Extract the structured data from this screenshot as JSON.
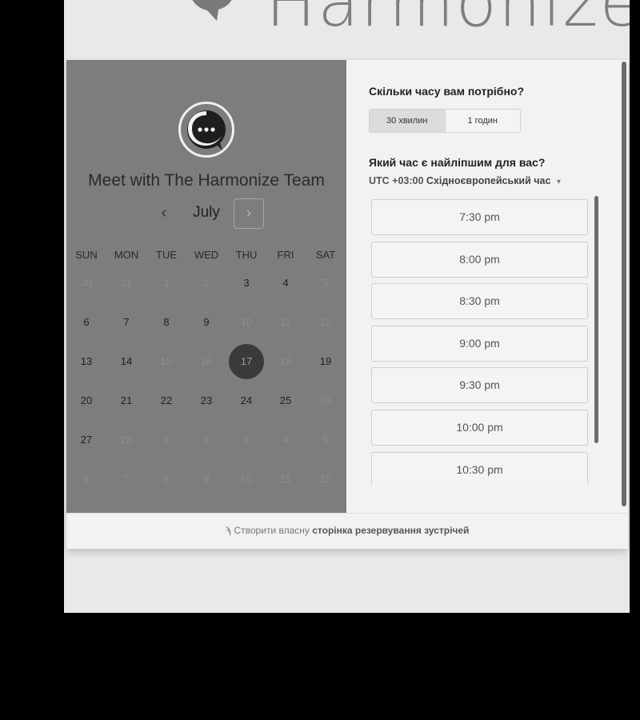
{
  "header": {
    "logo_text": "Harmonize"
  },
  "left_panel": {
    "title": "Meet with The Harmonize Team",
    "month": "July",
    "prev_icon": "‹",
    "next_icon": "›",
    "days_of_week": [
      "SUN",
      "MON",
      "TUE",
      "WED",
      "THU",
      "FRI",
      "SAT"
    ],
    "weeks": [
      [
        {
          "d": "30",
          "s": "past"
        },
        {
          "d": "31",
          "s": "past"
        },
        {
          "d": "1",
          "s": "past"
        },
        {
          "d": "2",
          "s": "past"
        },
        {
          "d": "3",
          "s": "avail"
        },
        {
          "d": "4",
          "s": "avail"
        },
        {
          "d": "5",
          "s": "past"
        }
      ],
      [
        {
          "d": "6",
          "s": "avail"
        },
        {
          "d": "7",
          "s": "avail"
        },
        {
          "d": "8",
          "s": "avail"
        },
        {
          "d": "9",
          "s": "avail"
        },
        {
          "d": "10",
          "s": "past"
        },
        {
          "d": "11",
          "s": "past"
        },
        {
          "d": "12",
          "s": "past"
        }
      ],
      [
        {
          "d": "13",
          "s": "avail"
        },
        {
          "d": "14",
          "s": "avail"
        },
        {
          "d": "15",
          "s": "past"
        },
        {
          "d": "16",
          "s": "past"
        },
        {
          "d": "17",
          "s": "selected"
        },
        {
          "d": "18",
          "s": "past"
        },
        {
          "d": "19",
          "s": "avail"
        }
      ],
      [
        {
          "d": "20",
          "s": "avail"
        },
        {
          "d": "21",
          "s": "avail"
        },
        {
          "d": "22",
          "s": "avail"
        },
        {
          "d": "23",
          "s": "avail"
        },
        {
          "d": "24",
          "s": "avail"
        },
        {
          "d": "25",
          "s": "avail"
        },
        {
          "d": "26",
          "s": "past"
        }
      ],
      [
        {
          "d": "27",
          "s": "avail"
        },
        {
          "d": "28",
          "s": "past"
        },
        {
          "d": "1",
          "s": "past"
        },
        {
          "d": "2",
          "s": "past"
        },
        {
          "d": "3",
          "s": "past"
        },
        {
          "d": "4",
          "s": "past"
        },
        {
          "d": "5",
          "s": "past"
        }
      ],
      [
        {
          "d": "6",
          "s": "past"
        },
        {
          "d": "7",
          "s": "past"
        },
        {
          "d": "8",
          "s": "past"
        },
        {
          "d": "9",
          "s": "past"
        },
        {
          "d": "10",
          "s": "past"
        },
        {
          "d": "11",
          "s": "past"
        },
        {
          "d": "12",
          "s": "past"
        }
      ]
    ]
  },
  "right_panel": {
    "duration_question": "Скільки часу вам потрібно?",
    "durations": [
      "30 хвилин",
      "1 годин"
    ],
    "selected_duration": "30 хвилин",
    "time_question": "Який час є найліпшим для вас?",
    "timezone_offset": "UTC +03:00",
    "timezone_name": "Східноєвропейський час",
    "timezone_caret": "▾",
    "slots": [
      "7:30 pm",
      "8:00 pm",
      "8:30 pm",
      "9:00 pm",
      "9:30 pm",
      "10:00 pm",
      "10:30 pm"
    ]
  },
  "footer": {
    "icon": "ϡ",
    "prefix": "Створити власну",
    "cta": "сторінка резервування зустрічей"
  }
}
